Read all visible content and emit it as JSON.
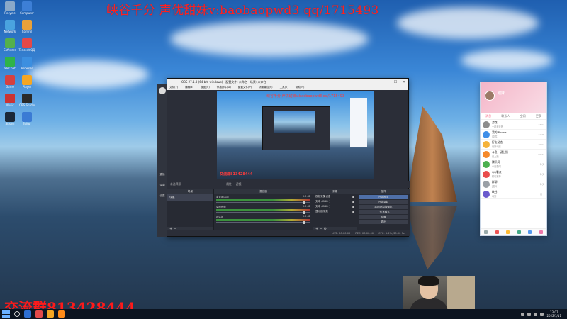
{
  "watermarks": {
    "top": "峡谷千分 声优甜妹v:baobaopwd3 qq/1715493",
    "bottom": "交流群813428444"
  },
  "desktop": {
    "icons": [
      {
        "label": "Recycle",
        "color": "#8aa9c9"
      },
      {
        "label": "Computer",
        "color": "#3d7fd6"
      },
      {
        "label": "Network",
        "color": "#4aa3df"
      },
      {
        "label": "Control",
        "color": "#e8a13a"
      },
      {
        "label": "Software",
        "color": "#54b04c"
      },
      {
        "label": "Tencent QQ",
        "color": "#e54848"
      },
      {
        "label": "WeChat",
        "color": "#2fb34a"
      },
      {
        "label": "Browser",
        "color": "#3c8fe0"
      },
      {
        "label": "Game",
        "color": "#d64040"
      },
      {
        "label": "Player",
        "color": "#f5a623"
      },
      {
        "label": "Music",
        "color": "#c33"
      },
      {
        "label": "OBS Studio",
        "color": "#2a2a2a"
      },
      {
        "label": "Steam",
        "color": "#1b2838"
      },
      {
        "label": "Editor",
        "color": "#3b7bd4"
      }
    ]
  },
  "obs": {
    "title": "OBS 27.1.3 (64-bit, windows) - 配置文件: 未命名 - 场景: 未命名",
    "menu": [
      "文件(F)",
      "编辑(E)",
      "视图(V)",
      "停靠部件(D)",
      "配置文件(P)",
      "场景集合(S)",
      "工具(T)",
      "帮助(H)"
    ],
    "side_labels": [
      "直播",
      "录制",
      "设置"
    ],
    "preview_watermark": "峡谷千分 声优甜妹v:baobaopwd3 qq/1715493",
    "preview_bottom": "交流群813428444",
    "status_row": {
      "left": "未选择源",
      "tags": [
        "属性",
        "滤镜"
      ]
    },
    "docks": {
      "scenes": {
        "header": "场景",
        "items": [
          "场景"
        ]
      },
      "sources": {
        "header": "来源",
        "items": [
          "视频采集设备",
          "文本 (GDI+)",
          "文本 (GDI+)",
          "显示器采集"
        ]
      },
      "mixer": {
        "header": "混音器",
        "channels": [
          {
            "name": "麦克风/Aux",
            "db": "0.0 dB"
          },
          {
            "name": "桌面音频",
            "db": "0.0 dB"
          },
          {
            "name": "媒体源",
            "db": "0.0 dB"
          }
        ]
      },
      "transitions": {
        "header": "转场"
      },
      "controls": {
        "header": "控件",
        "buttons": [
          "开始推流",
          "开始录制",
          "启动虚拟摄像机",
          "工作室模式",
          "设置",
          "退出"
        ],
        "active_index": 0
      }
    },
    "statusbar": [
      "LIVE: 00:00:00",
      "REC: 00:00:00",
      "CPU: 6.3%, 30.00 fps"
    ]
  },
  "qq": {
    "user": "甜妹",
    "tabs": [
      "消息",
      "联系人",
      "空间",
      "更多"
    ],
    "active_tab": 0,
    "conversations": [
      {
        "title": "游戏",
        "sub": "一起来玩吧",
        "time": "13:07",
        "color": "#8c8c8c"
      },
      {
        "title": "我的iPhone",
        "sub": "[文件]",
        "time": "11:45",
        "color": "#3e8ee8"
      },
      {
        "title": "好友动态",
        "sub": "有新动态",
        "time": "10:02",
        "color": "#f5b33b"
      },
      {
        "title": "斗鱼一键上播",
        "sub": "已上播",
        "time": "09:31",
        "color": "#f5892b"
      },
      {
        "title": "腾讯网",
        "sub": "今日要闻",
        "time": "昨天",
        "color": "#4cb050"
      },
      {
        "title": "QQ看点",
        "sub": "精彩推荐",
        "time": "昨天",
        "color": "#e94d4d"
      },
      {
        "title": "群聊",
        "sub": "[图片]",
        "time": "昨天",
        "color": "#9aa0a6"
      },
      {
        "title": "峡谷",
        "sub": "收到",
        "time": "周一",
        "color": "#6a5acd"
      }
    ]
  },
  "taskbar": {
    "time": "13:07",
    "date": "2022/1/11"
  }
}
